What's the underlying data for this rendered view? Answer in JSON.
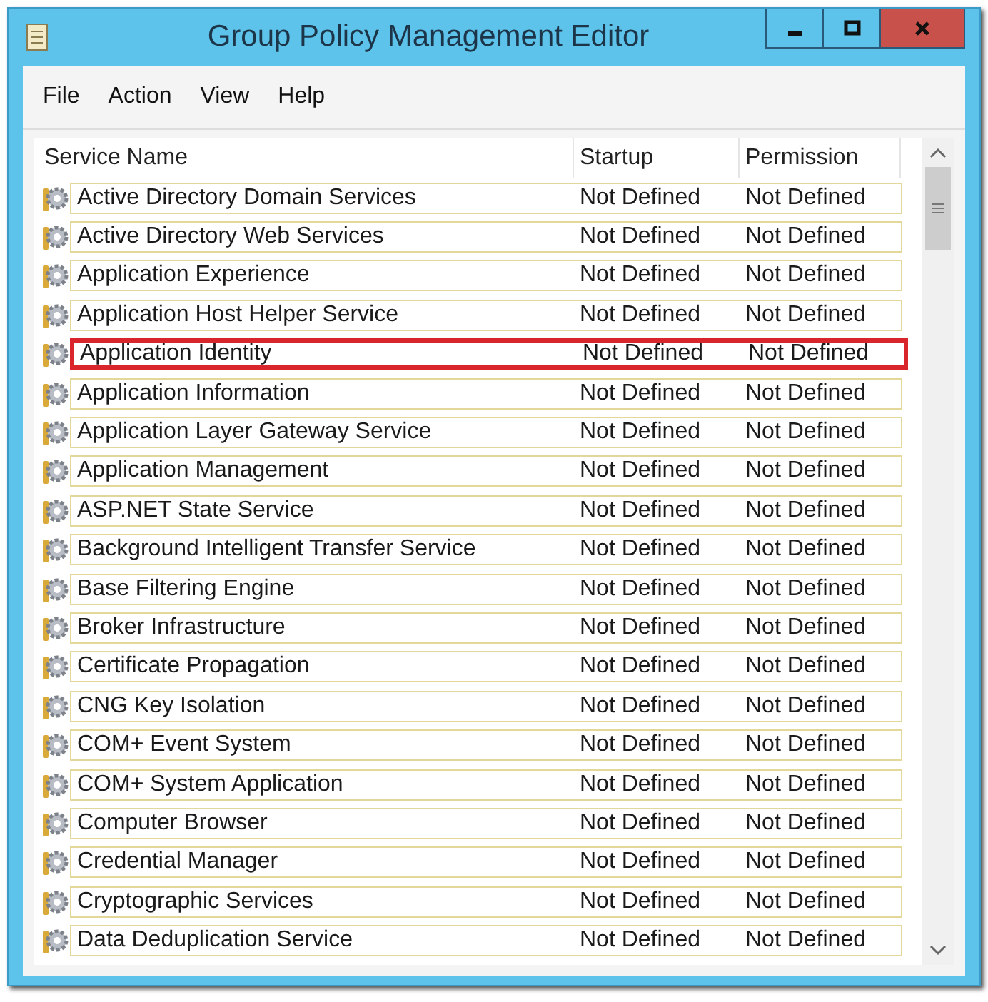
{
  "window": {
    "title": "Group Policy Management Editor"
  },
  "menu": [
    "File",
    "Action",
    "View",
    "Help"
  ],
  "table": {
    "columns": [
      "Service Name",
      "Startup",
      "Permission"
    ],
    "rows": [
      {
        "name": "Active Directory Domain Services",
        "startup": "Not Defined",
        "permission": "Not Defined",
        "highlighted": false
      },
      {
        "name": "Active Directory Web Services",
        "startup": "Not Defined",
        "permission": "Not Defined",
        "highlighted": false
      },
      {
        "name": "Application Experience",
        "startup": "Not Defined",
        "permission": "Not Defined",
        "highlighted": false
      },
      {
        "name": "Application Host Helper Service",
        "startup": "Not Defined",
        "permission": "Not Defined",
        "highlighted": false
      },
      {
        "name": "Application Identity",
        "startup": "Not Defined",
        "permission": "Not Defined",
        "highlighted": true
      },
      {
        "name": "Application Information",
        "startup": "Not Defined",
        "permission": "Not Defined",
        "highlighted": false
      },
      {
        "name": "Application Layer Gateway Service",
        "startup": "Not Defined",
        "permission": "Not Defined",
        "highlighted": false
      },
      {
        "name": "Application Management",
        "startup": "Not Defined",
        "permission": "Not Defined",
        "highlighted": false
      },
      {
        "name": "ASP.NET State Service",
        "startup": "Not Defined",
        "permission": "Not Defined",
        "highlighted": false
      },
      {
        "name": "Background Intelligent Transfer Service",
        "startup": "Not Defined",
        "permission": "Not Defined",
        "highlighted": false
      },
      {
        "name": "Base Filtering Engine",
        "startup": "Not Defined",
        "permission": "Not Defined",
        "highlighted": false
      },
      {
        "name": "Broker Infrastructure",
        "startup": "Not Defined",
        "permission": "Not Defined",
        "highlighted": false
      },
      {
        "name": "Certificate Propagation",
        "startup": "Not Defined",
        "permission": "Not Defined",
        "highlighted": false
      },
      {
        "name": "CNG Key Isolation",
        "startup": "Not Defined",
        "permission": "Not Defined",
        "highlighted": false
      },
      {
        "name": "COM+ Event System",
        "startup": "Not Defined",
        "permission": "Not Defined",
        "highlighted": false
      },
      {
        "name": "COM+ System Application",
        "startup": "Not Defined",
        "permission": "Not Defined",
        "highlighted": false
      },
      {
        "name": "Computer Browser",
        "startup": "Not Defined",
        "permission": "Not Defined",
        "highlighted": false
      },
      {
        "name": "Credential Manager",
        "startup": "Not Defined",
        "permission": "Not Defined",
        "highlighted": false
      },
      {
        "name": "Cryptographic Services",
        "startup": "Not Defined",
        "permission": "Not Defined",
        "highlighted": false
      },
      {
        "name": "Data Deduplication Service",
        "startup": "Not Defined",
        "permission": "Not Defined",
        "highlighted": false
      }
    ]
  }
}
